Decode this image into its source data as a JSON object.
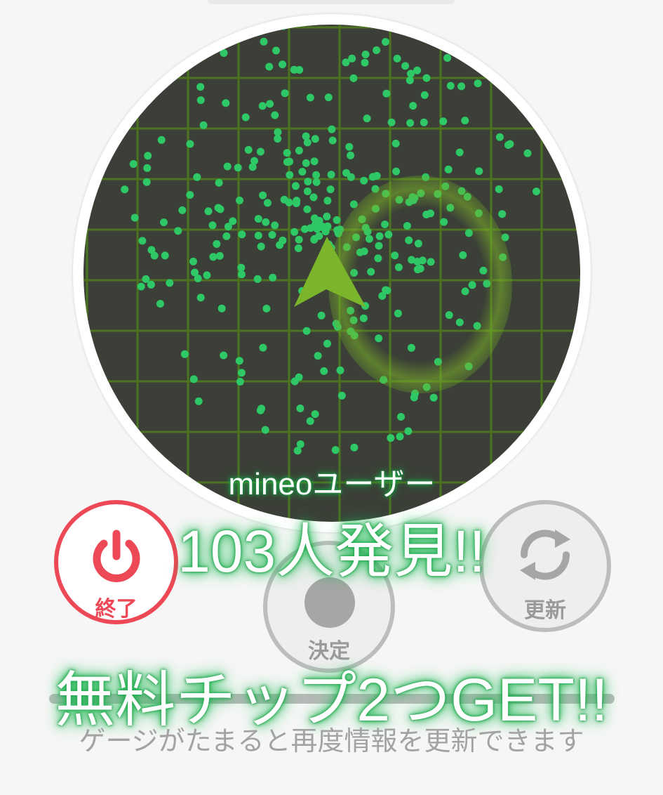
{
  "radar": {
    "label": "mineoユーザー",
    "arrow_color": "#7ab52c",
    "dot_color": "#2ec866",
    "grid_color": "#4f7a1e",
    "background_color": "#3b3f37"
  },
  "overlay": {
    "found_count": "103人発見!!",
    "reward": "無料チップ2つGET!!"
  },
  "buttons": {
    "end_label": "終了",
    "decide_label": "決定",
    "refresh_label": "更新",
    "end_color": "#ec4856",
    "inactive_color": "#a6a6a6"
  },
  "gauge": {
    "fill_fraction": 0.0,
    "hint": "ゲージがたまると再度情報を更新できます"
  },
  "icons": {
    "end": "power-icon",
    "decide": "dot-icon",
    "refresh": "refresh-icon",
    "location": "navigation-arrow-icon"
  }
}
